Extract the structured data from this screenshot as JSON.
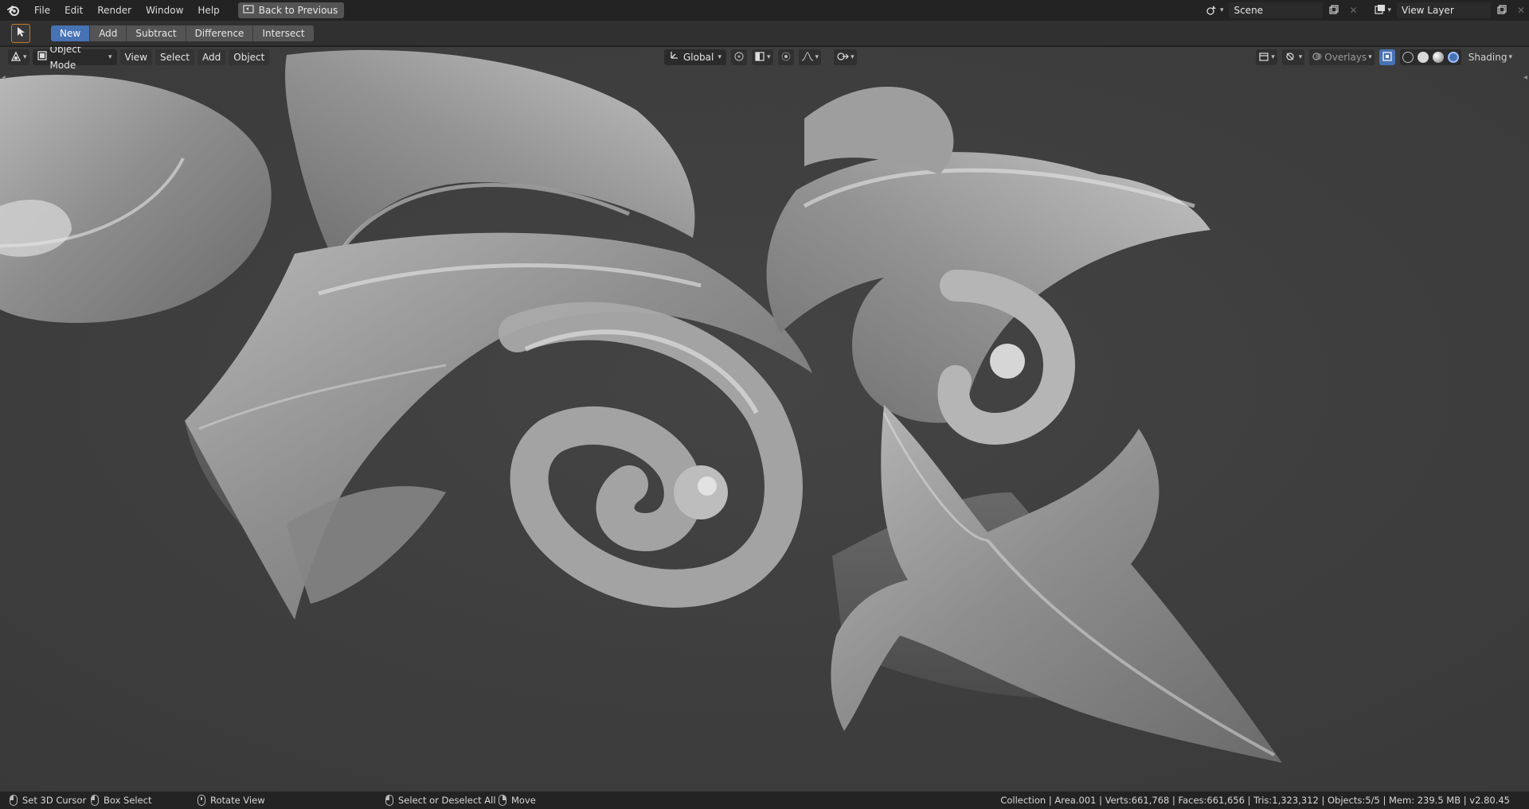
{
  "topbar": {
    "menus": [
      "File",
      "Edit",
      "Render",
      "Window",
      "Help"
    ],
    "back_label": "Back to Previous",
    "scene_name": "Scene",
    "view_layer": "View Layer"
  },
  "toolheader": {
    "ops": [
      "New",
      "Add",
      "Subtract",
      "Difference",
      "Intersect"
    ],
    "active_op": "New"
  },
  "viewport_header": {
    "mode": "Object Mode",
    "menus": [
      "View",
      "Select",
      "Add",
      "Object"
    ],
    "orientation": "Global",
    "overlays_label": "Overlays",
    "shading_label": "Shading"
  },
  "statusbar": {
    "hints": [
      {
        "mouse": "left",
        "label": "Set 3D Cursor"
      },
      {
        "mouse": "left",
        "label": "Box Select"
      },
      {
        "mouse": "middle",
        "label": "Rotate View"
      },
      {
        "mouse": "left",
        "label": "Select or Deselect All"
      },
      {
        "mouse": "right",
        "label": "Move"
      }
    ],
    "stats": "Collection | Area.001 | Verts:661,768 | Faces:661,656 | Tris:1,323,312 | Objects:5/5 | Mem: 239.5 MB | v2.80.45"
  },
  "colors": {
    "accent": "#4772b3",
    "active_tool_border": "#c77a25",
    "viewport_bg": "#3d3d3d"
  }
}
